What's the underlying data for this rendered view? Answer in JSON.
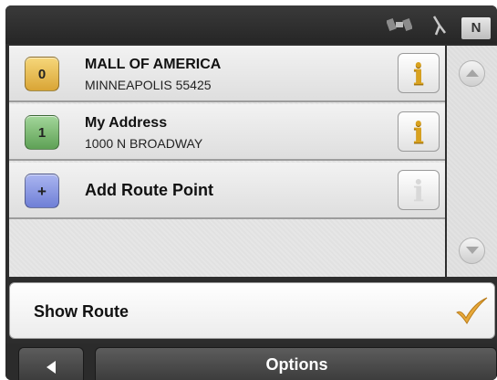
{
  "status": {
    "compass_label": "N",
    "icons": [
      "satellite-icon",
      "gps-signal-icon"
    ]
  },
  "route_points": [
    {
      "index": "0",
      "name": "MALL OF AMERICA",
      "detail": "MINNEAPOLIS 55425",
      "badge_color": "#e7b84f",
      "icon": "info-icon"
    },
    {
      "index": "1",
      "name": "My Address",
      "detail": "1000 N BROADWAY",
      "badge_color": "#79b86e",
      "icon": "info-icon"
    },
    {
      "index": "+",
      "name": "Add Route Point",
      "detail": "",
      "badge_color": "#8593e0",
      "icon": "info-icon"
    }
  ],
  "info_glyph": "i",
  "scroll": {
    "up_icon": "chevron-up-icon",
    "down_icon": "chevron-down-icon"
  },
  "show_route": {
    "label": "Show Route",
    "icon": "checkmark-icon",
    "check_color": "#e8a93a"
  },
  "bottom": {
    "back_icon": "back-arrow-icon",
    "options_label": "Options"
  }
}
